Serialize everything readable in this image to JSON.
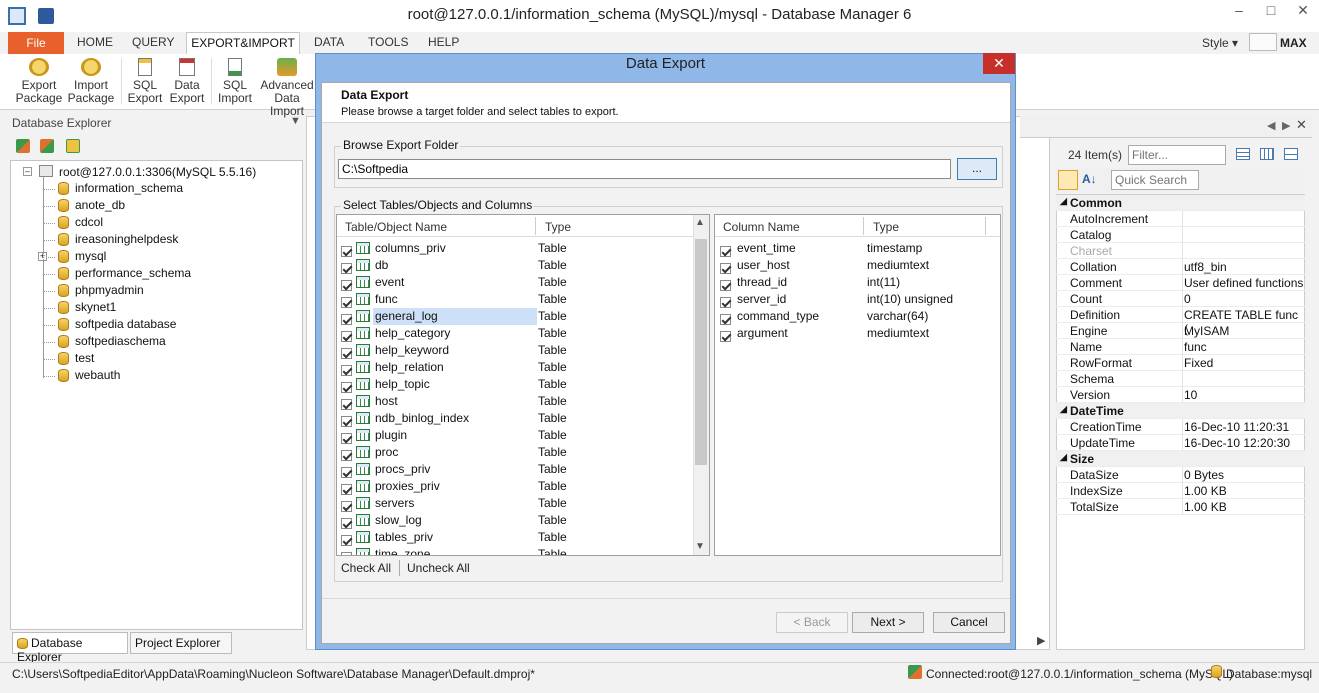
{
  "window": {
    "title": "root@127.0.0.1/information_schema (MySQL)/mysql - Database Manager 6"
  },
  "menu": {
    "file": "File",
    "tabs": [
      "HOME",
      "QUERY",
      "EXPORT&IMPORT",
      "DATA",
      "TOOLS",
      "HELP"
    ],
    "style": "Style",
    "max": "MAX"
  },
  "ribbon": {
    "buttons": [
      {
        "line1": "Export",
        "line2": "Package",
        "icon": "export-package-icon"
      },
      {
        "line1": "Import",
        "line2": "Package",
        "icon": "import-package-icon"
      },
      {
        "line1": "SQL",
        "line2": "Export",
        "icon": "sql-export-icon"
      },
      {
        "line1": "Data",
        "line2": "Export",
        "icon": "data-export-icon"
      },
      {
        "line1": "SQL",
        "line2": "Import",
        "icon": "sql-import-icon"
      },
      {
        "line1": "Advanced",
        "line2": "Data Import",
        "icon": "advanced-import-icon"
      }
    ]
  },
  "explorer": {
    "title": "Database Explorer",
    "root": "root@127.0.0.1:3306(MySQL 5.5.16)",
    "databases": [
      "information_schema",
      "anote_db",
      "cdcol",
      "ireasoninghelpdesk",
      "mysql",
      "performance_schema",
      "phpmyadmin",
      "skynet1",
      "softpedia database",
      "softpediaschema",
      "test",
      "webauth"
    ],
    "tab_db": "Database Explorer",
    "tab_project": "Project Explorer"
  },
  "right_panel": {
    "items_count": "24 Item(s)",
    "filter_placeholder": "Filter...",
    "quick_search": "Quick Search",
    "properties": [
      {
        "cat": "Common"
      },
      {
        "k": "AutoIncrement",
        "v": ""
      },
      {
        "k": "Catalog",
        "v": ""
      },
      {
        "k": "Charset",
        "v": "",
        "muted": true
      },
      {
        "k": "Collation",
        "v": "utf8_bin"
      },
      {
        "k": "Comment",
        "v": "User defined functions"
      },
      {
        "k": "Count",
        "v": "0"
      },
      {
        "k": "Definition",
        "v": "CREATE TABLE func ("
      },
      {
        "k": "Engine",
        "v": "MyISAM"
      },
      {
        "k": "Name",
        "v": "func"
      },
      {
        "k": "RowFormat",
        "v": "Fixed"
      },
      {
        "k": "Schema",
        "v": ""
      },
      {
        "k": "Version",
        "v": "10"
      },
      {
        "cat": "DateTime"
      },
      {
        "k": "CreationTime",
        "v": "16-Dec-10 11:20:31"
      },
      {
        "k": "UpdateTime",
        "v": "16-Dec-10 12:20:30"
      },
      {
        "cat": "Size"
      },
      {
        "k": "DataSize",
        "v": "0 Bytes"
      },
      {
        "k": "IndexSize",
        "v": "1.00 KB"
      },
      {
        "k": "TotalSize",
        "v": "1.00 KB"
      }
    ]
  },
  "dialog": {
    "title": "Data Export",
    "header_title": "Data Export",
    "header_sub": "Please browse a target folder and select tables to export.",
    "browse_label": "Browse Export Folder",
    "folder_value": "C:\\Softpedia",
    "browse_btn": "...",
    "select_label": "Select Tables/Objects and Columns",
    "tables_headers": [
      "Table/Object Name",
      "Type"
    ],
    "tables": [
      {
        "name": "columns_priv",
        "type": "Table"
      },
      {
        "name": "db",
        "type": "Table"
      },
      {
        "name": "event",
        "type": "Table"
      },
      {
        "name": "func",
        "type": "Table"
      },
      {
        "name": "general_log",
        "type": "Table",
        "selected": true
      },
      {
        "name": "help_category",
        "type": "Table"
      },
      {
        "name": "help_keyword",
        "type": "Table"
      },
      {
        "name": "help_relation",
        "type": "Table"
      },
      {
        "name": "help_topic",
        "type": "Table"
      },
      {
        "name": "host",
        "type": "Table"
      },
      {
        "name": "ndb_binlog_index",
        "type": "Table"
      },
      {
        "name": "plugin",
        "type": "Table"
      },
      {
        "name": "proc",
        "type": "Table"
      },
      {
        "name": "procs_priv",
        "type": "Table"
      },
      {
        "name": "proxies_priv",
        "type": "Table"
      },
      {
        "name": "servers",
        "type": "Table"
      },
      {
        "name": "slow_log",
        "type": "Table"
      },
      {
        "name": "tables_priv",
        "type": "Table"
      },
      {
        "name": "time_zone",
        "type": "Table"
      }
    ],
    "columns_headers": [
      "Column Name",
      "Type"
    ],
    "columns": [
      {
        "name": "event_time",
        "type": "timestamp"
      },
      {
        "name": "user_host",
        "type": "mediumtext"
      },
      {
        "name": "thread_id",
        "type": "int(11)"
      },
      {
        "name": "server_id",
        "type": "int(10) unsigned"
      },
      {
        "name": "command_type",
        "type": "varchar(64)"
      },
      {
        "name": "argument",
        "type": "mediumtext"
      }
    ],
    "check_all": "Check All",
    "uncheck_all": "Uncheck All",
    "back": "< Back",
    "next": "Next >",
    "cancel": "Cancel"
  },
  "status": {
    "path": "C:\\Users\\SoftpediaEditor\\AppData\\Roaming\\Nucleon Software\\Database Manager\\Default.dmproj*",
    "connected": "Connected:root@127.0.0.1/information_schema (MySQL)",
    "database": "Database:mysql"
  },
  "colors": {
    "accent": "#e8602c",
    "dialog_frame": "#8fb8e8",
    "close": "#c7302a",
    "selection": "#cde0f7"
  }
}
